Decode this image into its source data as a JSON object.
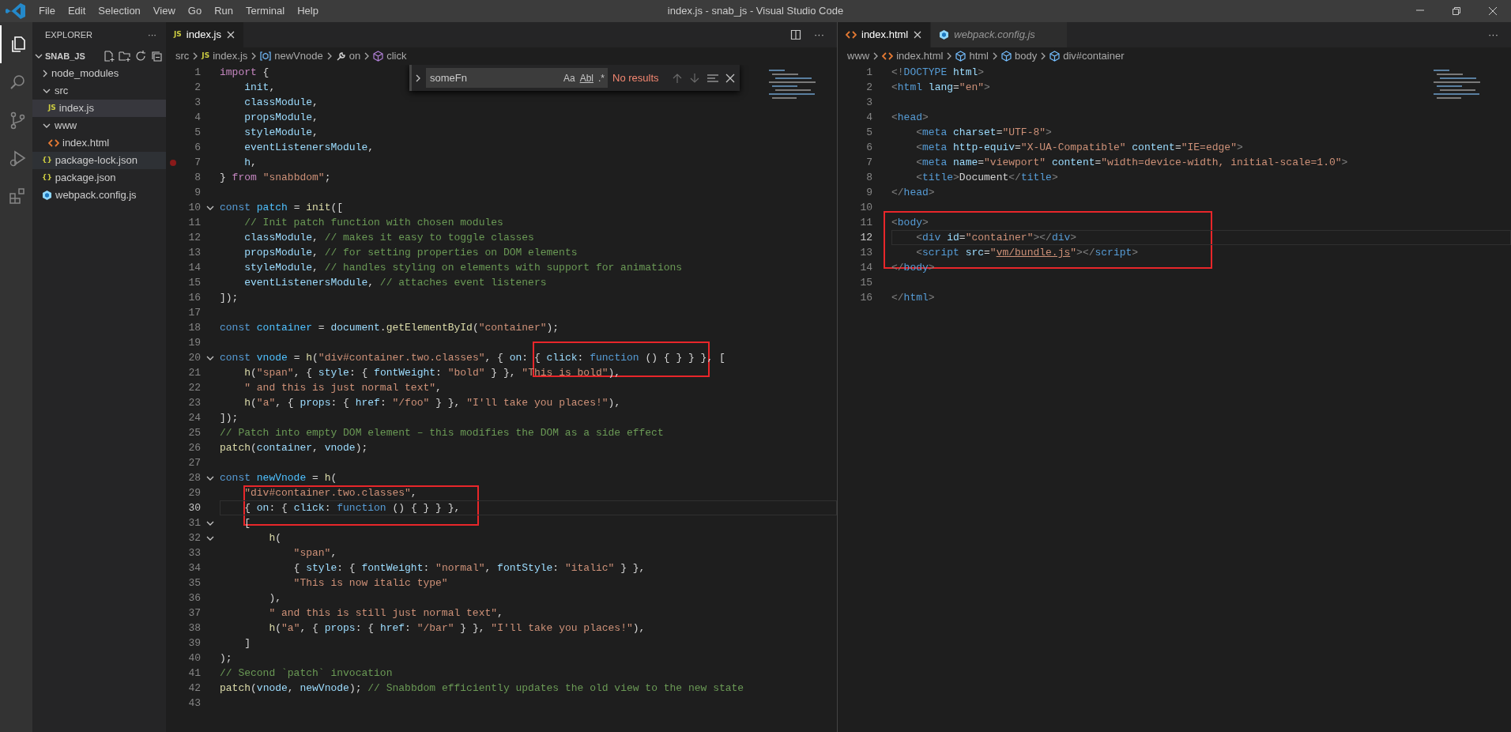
{
  "window": {
    "title": "index.js - snab_js - Visual Studio Code",
    "menu": [
      "File",
      "Edit",
      "Selection",
      "View",
      "Go",
      "Run",
      "Terminal",
      "Help"
    ]
  },
  "activity_bar": [
    {
      "kind": "files",
      "selected": true
    },
    {
      "kind": "search",
      "selected": false
    },
    {
      "kind": "source-control",
      "selected": false
    },
    {
      "kind": "debug",
      "selected": false
    },
    {
      "kind": "extensions",
      "selected": false
    }
  ],
  "sidebar": {
    "title": "EXPLORER",
    "more": "···",
    "section": {
      "label": "SNAB_JS",
      "expanded": true
    },
    "items": [
      {
        "label": "node_modules",
        "kind": "folder",
        "expanded": false,
        "selected": false,
        "hovered": false
      },
      {
        "label": "src",
        "kind": "folder",
        "expanded": true,
        "selected": false,
        "hovered": false,
        "children": [
          {
            "label": "index.js",
            "kind": "js",
            "badge": "JS",
            "selected": true,
            "hovered": false
          }
        ]
      },
      {
        "label": "www",
        "kind": "folder",
        "expanded": true,
        "selected": false,
        "hovered": false,
        "children": [
          {
            "label": "index.html",
            "kind": "html",
            "selected": false,
            "hovered": false
          }
        ]
      },
      {
        "label": "package-lock.json",
        "kind": "json",
        "badge": "{}",
        "selected": false,
        "hovered": true
      },
      {
        "label": "package.json",
        "kind": "json",
        "badge": "{}",
        "selected": false,
        "hovered": false
      },
      {
        "label": "webpack.config.js",
        "kind": "webpack",
        "selected": false,
        "hovered": false
      }
    ]
  },
  "editors": [
    {
      "tabs": [
        {
          "label": "index.js",
          "kind": "js",
          "badge": "JS",
          "selected": true,
          "preview": false
        }
      ],
      "actions": [
        {
          "kind": "split"
        },
        {
          "kind": "more",
          "label": "···"
        }
      ],
      "breadcrumbs": [
        {
          "label": "src",
          "kind": "folder"
        },
        {
          "label": "index.js",
          "kind": "js",
          "badge": "JS"
        },
        {
          "label": "newVnode",
          "kind": "variable"
        },
        {
          "label": "on",
          "kind": "property"
        },
        {
          "label": "click",
          "kind": "method"
        }
      ],
      "find": {
        "value": "someFn",
        "options": [
          "Aa",
          "Abl",
          ".*"
        ],
        "result": "No results"
      },
      "lines": [
        {
          "num": "1",
          "fold": false,
          "breakpoint": false,
          "current": false,
          "tokens": [
            {
              "kind": "ctl",
              "text": "import"
            },
            {
              "kind": "txt",
              "text": " {"
            }
          ]
        },
        {
          "num": "2",
          "fold": false,
          "breakpoint": false,
          "current": false,
          "tokens": [
            {
              "kind": "var",
              "text": "    init"
            },
            {
              "kind": "txt",
              "text": ","
            }
          ]
        },
        {
          "num": "3",
          "fold": false,
          "breakpoint": false,
          "current": false,
          "tokens": [
            {
              "kind": "var",
              "text": "    classModule"
            },
            {
              "kind": "txt",
              "text": ","
            }
          ]
        },
        {
          "num": "4",
          "fold": false,
          "breakpoint": false,
          "current": false,
          "tokens": [
            {
              "kind": "var",
              "text": "    propsModule"
            },
            {
              "kind": "txt",
              "text": ","
            }
          ]
        },
        {
          "num": "5",
          "fold": false,
          "breakpoint": false,
          "current": false,
          "tokens": [
            {
              "kind": "var",
              "text": "    styleModule"
            },
            {
              "kind": "txt",
              "text": ","
            }
          ]
        },
        {
          "num": "6",
          "fold": false,
          "breakpoint": false,
          "current": false,
          "tokens": [
            {
              "kind": "var",
              "text": "    eventListenersModule"
            },
            {
              "kind": "txt",
              "text": ","
            }
          ]
        },
        {
          "num": "7",
          "fold": false,
          "breakpoint": true,
          "current": false,
          "tokens": [
            {
              "kind": "var",
              "text": "    h"
            },
            {
              "kind": "txt",
              "text": ","
            }
          ]
        },
        {
          "num": "8",
          "fold": false,
          "breakpoint": false,
          "current": false,
          "tokens": [
            {
              "kind": "txt",
              "text": "} "
            },
            {
              "kind": "ctl",
              "text": "from "
            },
            {
              "kind": "str",
              "text": "\"snabbdom\""
            },
            {
              "kind": "txt",
              "text": ";"
            }
          ]
        },
        {
          "num": "9",
          "fold": false,
          "breakpoint": false,
          "current": false
        },
        {
          "num": "10",
          "fold": true,
          "breakpoint": false,
          "current": false,
          "tokens": [
            {
              "kind": "kw",
              "text": "const "
            },
            {
              "kind": "const",
              "text": "patch"
            },
            {
              "kind": "txt",
              "text": " = "
            },
            {
              "kind": "fn",
              "text": "init"
            },
            {
              "kind": "txt",
              "text": "(["
            }
          ]
        },
        {
          "num": "11",
          "fold": false,
          "breakpoint": false,
          "current": false,
          "tokens": [
            {
              "kind": "cmt",
              "text": "    // Init patch function with chosen modules"
            }
          ]
        },
        {
          "num": "12",
          "fold": false,
          "breakpoint": false,
          "current": false,
          "tokens": [
            {
              "kind": "var",
              "text": "    classModule"
            },
            {
              "kind": "txt",
              "text": ", "
            },
            {
              "kind": "cmt",
              "text": "// makes it easy to toggle classes"
            }
          ]
        },
        {
          "num": "13",
          "fold": false,
          "breakpoint": false,
          "current": false,
          "tokens": [
            {
              "kind": "var",
              "text": "    propsModule"
            },
            {
              "kind": "txt",
              "text": ", "
            },
            {
              "kind": "cmt",
              "text": "// for setting properties on DOM elements"
            }
          ]
        },
        {
          "num": "14",
          "fold": false,
          "breakpoint": false,
          "current": false,
          "tokens": [
            {
              "kind": "var",
              "text": "    styleModule"
            },
            {
              "kind": "txt",
              "text": ", "
            },
            {
              "kind": "cmt",
              "text": "// handles styling on elements with support for animations"
            }
          ]
        },
        {
          "num": "15",
          "fold": false,
          "breakpoint": false,
          "current": false,
          "tokens": [
            {
              "kind": "var",
              "text": "    eventListenersModule"
            },
            {
              "kind": "txt",
              "text": ", "
            },
            {
              "kind": "cmt",
              "text": "// attaches event listeners"
            }
          ]
        },
        {
          "num": "16",
          "fold": false,
          "breakpoint": false,
          "current": false,
          "tokens": [
            {
              "kind": "txt",
              "text": "]);"
            }
          ]
        },
        {
          "num": "17",
          "fold": false,
          "breakpoint": false,
          "current": false
        },
        {
          "num": "18",
          "fold": false,
          "breakpoint": false,
          "current": false,
          "tokens": [
            {
              "kind": "kw",
              "text": "const "
            },
            {
              "kind": "const",
              "text": "container"
            },
            {
              "kind": "txt",
              "text": " = "
            },
            {
              "kind": "var",
              "text": "document"
            },
            {
              "kind": "txt",
              "text": "."
            },
            {
              "kind": "fn",
              "text": "getElementById"
            },
            {
              "kind": "txt",
              "text": "("
            },
            {
              "kind": "str",
              "text": "\"container\""
            },
            {
              "kind": "txt",
              "text": ");"
            }
          ]
        },
        {
          "num": "19",
          "fold": false,
          "breakpoint": false,
          "current": false
        },
        {
          "num": "20",
          "fold": true,
          "breakpoint": false,
          "current": false,
          "tokens": [
            {
              "kind": "kw",
              "text": "const "
            },
            {
              "kind": "const",
              "text": "vnode"
            },
            {
              "kind": "txt",
              "text": " = "
            },
            {
              "kind": "fn",
              "text": "h"
            },
            {
              "kind": "txt",
              "text": "("
            },
            {
              "kind": "str",
              "text": "\"div#container.two.classes\""
            },
            {
              "kind": "txt",
              "text": ", { "
            },
            {
              "kind": "var",
              "text": "on"
            },
            {
              "kind": "txt",
              "text": ": { "
            },
            {
              "kind": "var",
              "text": "click"
            },
            {
              "kind": "txt",
              "text": ": "
            },
            {
              "kind": "kw",
              "text": "function"
            },
            {
              "kind": "txt",
              "text": " () { } } }, ["
            }
          ]
        },
        {
          "num": "21",
          "fold": false,
          "breakpoint": false,
          "current": false,
          "tokens": [
            {
              "kind": "fn",
              "text": "    h"
            },
            {
              "kind": "txt",
              "text": "("
            },
            {
              "kind": "str",
              "text": "\"span\""
            },
            {
              "kind": "txt",
              "text": ", { "
            },
            {
              "kind": "var",
              "text": "style"
            },
            {
              "kind": "txt",
              "text": ": { "
            },
            {
              "kind": "var",
              "text": "fontWeight"
            },
            {
              "kind": "txt",
              "text": ": "
            },
            {
              "kind": "str",
              "text": "\"bold\""
            },
            {
              "kind": "txt",
              "text": " } }, "
            },
            {
              "kind": "str",
              "text": "\"This is bold\""
            },
            {
              "kind": "txt",
              "text": "),"
            }
          ]
        },
        {
          "num": "22",
          "fold": false,
          "breakpoint": false,
          "current": false,
          "tokens": [
            {
              "kind": "str",
              "text": "    \" and this is just normal text\""
            },
            {
              "kind": "txt",
              "text": ","
            }
          ]
        },
        {
          "num": "23",
          "fold": false,
          "breakpoint": false,
          "current": false,
          "tokens": [
            {
              "kind": "fn",
              "text": "    h"
            },
            {
              "kind": "txt",
              "text": "("
            },
            {
              "kind": "str",
              "text": "\"a\""
            },
            {
              "kind": "txt",
              "text": ", { "
            },
            {
              "kind": "var",
              "text": "props"
            },
            {
              "kind": "txt",
              "text": ": { "
            },
            {
              "kind": "var",
              "text": "href"
            },
            {
              "kind": "txt",
              "text": ": "
            },
            {
              "kind": "str",
              "text": "\"/foo\""
            },
            {
              "kind": "txt",
              "text": " } }, "
            },
            {
              "kind": "str",
              "text": "\"I'll take you places!\""
            },
            {
              "kind": "txt",
              "text": "),"
            }
          ]
        },
        {
          "num": "24",
          "fold": false,
          "breakpoint": false,
          "current": false,
          "tokens": [
            {
              "kind": "txt",
              "text": "]);"
            }
          ]
        },
        {
          "num": "25",
          "fold": false,
          "breakpoint": false,
          "current": false,
          "tokens": [
            {
              "kind": "cmt",
              "text": "// Patch into empty DOM element – this modifies the DOM as a side effect"
            }
          ]
        },
        {
          "num": "26",
          "fold": false,
          "breakpoint": false,
          "current": false,
          "tokens": [
            {
              "kind": "fn",
              "text": "patch"
            },
            {
              "kind": "txt",
              "text": "("
            },
            {
              "kind": "var",
              "text": "container"
            },
            {
              "kind": "txt",
              "text": ", "
            },
            {
              "kind": "var",
              "text": "vnode"
            },
            {
              "kind": "txt",
              "text": ");"
            }
          ]
        },
        {
          "num": "27",
          "fold": false,
          "breakpoint": false,
          "current": false
        },
        {
          "num": "28",
          "fold": true,
          "breakpoint": false,
          "current": false,
          "tokens": [
            {
              "kind": "kw",
              "text": "const "
            },
            {
              "kind": "const",
              "text": "newVnode"
            },
            {
              "kind": "txt",
              "text": " = "
            },
            {
              "kind": "fn",
              "text": "h"
            },
            {
              "kind": "txt",
              "text": "("
            }
          ]
        },
        {
          "num": "29",
          "fold": false,
          "breakpoint": false,
          "current": false,
          "tokens": [
            {
              "kind": "str",
              "text": "    \"div#container.two.classes\""
            },
            {
              "kind": "txt",
              "text": ","
            }
          ]
        },
        {
          "num": "30",
          "fold": false,
          "breakpoint": false,
          "current": true,
          "tokens": [
            {
              "kind": "txt",
              "text": "    { "
            },
            {
              "kind": "var",
              "text": "on"
            },
            {
              "kind": "txt",
              "text": ": { "
            },
            {
              "kind": "var",
              "text": "click"
            },
            {
              "kind": "txt",
              "text": ": "
            },
            {
              "kind": "kw",
              "text": "function"
            },
            {
              "kind": "txt",
              "text": " () { } } },"
            }
          ]
        },
        {
          "num": "31",
          "fold": true,
          "breakpoint": false,
          "current": false,
          "tokens": [
            {
              "kind": "txt",
              "text": "    ["
            }
          ]
        },
        {
          "num": "32",
          "fold": true,
          "breakpoint": false,
          "current": false,
          "tokens": [
            {
              "kind": "fn",
              "text": "        h"
            },
            {
              "kind": "txt",
              "text": "("
            }
          ]
        },
        {
          "num": "33",
          "fold": false,
          "breakpoint": false,
          "current": false,
          "tokens": [
            {
              "kind": "str",
              "text": "            \"span\""
            },
            {
              "kind": "txt",
              "text": ","
            }
          ]
        },
        {
          "num": "34",
          "fold": false,
          "breakpoint": false,
          "current": false,
          "tokens": [
            {
              "kind": "txt",
              "text": "            { "
            },
            {
              "kind": "var",
              "text": "style"
            },
            {
              "kind": "txt",
              "text": ": { "
            },
            {
              "kind": "var",
              "text": "fontWeight"
            },
            {
              "kind": "txt",
              "text": ": "
            },
            {
              "kind": "str",
              "text": "\"normal\""
            },
            {
              "kind": "txt",
              "text": ", "
            },
            {
              "kind": "var",
              "text": "fontStyle"
            },
            {
              "kind": "txt",
              "text": ": "
            },
            {
              "kind": "str",
              "text": "\"italic\""
            },
            {
              "kind": "txt",
              "text": " } },"
            }
          ]
        },
        {
          "num": "35",
          "fold": false,
          "breakpoint": false,
          "current": false,
          "tokens": [
            {
              "kind": "str",
              "text": "            \"This is now italic type\""
            }
          ]
        },
        {
          "num": "36",
          "fold": false,
          "breakpoint": false,
          "current": false,
          "tokens": [
            {
              "kind": "txt",
              "text": "        ),"
            }
          ]
        },
        {
          "num": "37",
          "fold": false,
          "breakpoint": false,
          "current": false,
          "tokens": [
            {
              "kind": "str",
              "text": "        \" and this is still just normal text\""
            },
            {
              "kind": "txt",
              "text": ","
            }
          ]
        },
        {
          "num": "38",
          "fold": false,
          "breakpoint": false,
          "current": false,
          "tokens": [
            {
              "kind": "fn",
              "text": "        h"
            },
            {
              "kind": "txt",
              "text": "("
            },
            {
              "kind": "str",
              "text": "\"a\""
            },
            {
              "kind": "txt",
              "text": ", { "
            },
            {
              "kind": "var",
              "text": "props"
            },
            {
              "kind": "txt",
              "text": ": { "
            },
            {
              "kind": "var",
              "text": "href"
            },
            {
              "kind": "txt",
              "text": ": "
            },
            {
              "kind": "str",
              "text": "\"/bar\""
            },
            {
              "kind": "txt",
              "text": " } }, "
            },
            {
              "kind": "str",
              "text": "\"I'll take you places!\""
            },
            {
              "kind": "txt",
              "text": "),"
            }
          ]
        },
        {
          "num": "39",
          "fold": false,
          "breakpoint": false,
          "current": false,
          "tokens": [
            {
              "kind": "txt",
              "text": "    ]"
            }
          ]
        },
        {
          "num": "40",
          "fold": false,
          "breakpoint": false,
          "current": false,
          "tokens": [
            {
              "kind": "txt",
              "text": ");"
            }
          ]
        },
        {
          "num": "41",
          "fold": false,
          "breakpoint": false,
          "current": false,
          "tokens": [
            {
              "kind": "cmt",
              "text": "// Second `patch` invocation"
            }
          ]
        },
        {
          "num": "42",
          "fold": false,
          "breakpoint": false,
          "current": false,
          "tokens": [
            {
              "kind": "fn",
              "text": "patch"
            },
            {
              "kind": "txt",
              "text": "("
            },
            {
              "kind": "var",
              "text": "vnode"
            },
            {
              "kind": "txt",
              "text": ", "
            },
            {
              "kind": "var",
              "text": "newVnode"
            },
            {
              "kind": "txt",
              "text": "); "
            },
            {
              "kind": "cmt",
              "text": "// Snabbdom efficiently updates the old view to the new state"
            }
          ]
        },
        {
          "num": "43",
          "fold": false,
          "breakpoint": false,
          "current": false
        }
      ]
    },
    {
      "tabs": [
        {
          "label": "index.html",
          "kind": "html",
          "selected": true,
          "preview": false
        },
        {
          "label": "webpack.config.js",
          "kind": "webpack",
          "selected": false,
          "preview": true
        }
      ],
      "actions": [
        {
          "kind": "more",
          "label": "···"
        }
      ],
      "breadcrumbs": [
        {
          "label": "www",
          "kind": "folder"
        },
        {
          "label": "index.html",
          "kind": "html"
        },
        {
          "label": "html",
          "kind": "element"
        },
        {
          "label": "body",
          "kind": "element"
        },
        {
          "label": "div#container",
          "kind": "element"
        }
      ],
      "lines": [
        {
          "num": "1",
          "current": false,
          "tokens": [
            {
              "kind": "tag",
              "text": "<!"
            },
            {
              "kind": "kw",
              "text": "DOCTYPE "
            },
            {
              "kind": "var",
              "text": "html"
            },
            {
              "kind": "tag",
              "text": ">"
            }
          ]
        },
        {
          "num": "2",
          "current": false,
          "tokens": [
            {
              "kind": "tag",
              "text": "<"
            },
            {
              "kind": "kw",
              "text": "html "
            },
            {
              "kind": "var",
              "text": "lang"
            },
            {
              "kind": "txt",
              "text": "="
            },
            {
              "kind": "str",
              "text": "\"en\""
            },
            {
              "kind": "tag",
              "text": ">"
            }
          ]
        },
        {
          "num": "3",
          "current": false
        },
        {
          "num": "4",
          "current": false,
          "tokens": [
            {
              "kind": "tag",
              "text": "<"
            },
            {
              "kind": "kw",
              "text": "head"
            },
            {
              "kind": "tag",
              "text": ">"
            }
          ]
        },
        {
          "num": "5",
          "current": false,
          "tokens": [
            {
              "kind": "tag",
              "text": "    <"
            },
            {
              "kind": "kw",
              "text": "meta "
            },
            {
              "kind": "var",
              "text": "charset"
            },
            {
              "kind": "txt",
              "text": "="
            },
            {
              "kind": "str",
              "text": "\"UTF-8\""
            },
            {
              "kind": "tag",
              "text": ">"
            }
          ]
        },
        {
          "num": "6",
          "current": false,
          "tokens": [
            {
              "kind": "tag",
              "text": "    <"
            },
            {
              "kind": "kw",
              "text": "meta "
            },
            {
              "kind": "var",
              "text": "http-equiv"
            },
            {
              "kind": "txt",
              "text": "="
            },
            {
              "kind": "str",
              "text": "\"X-UA-Compatible\""
            },
            {
              "kind": "var",
              "text": " content"
            },
            {
              "kind": "txt",
              "text": "="
            },
            {
              "kind": "str",
              "text": "\"IE=edge\""
            },
            {
              "kind": "tag",
              "text": ">"
            }
          ]
        },
        {
          "num": "7",
          "current": false,
          "tokens": [
            {
              "kind": "tag",
              "text": "    <"
            },
            {
              "kind": "kw",
              "text": "meta "
            },
            {
              "kind": "var",
              "text": "name"
            },
            {
              "kind": "txt",
              "text": "="
            },
            {
              "kind": "str",
              "text": "\"viewport\""
            },
            {
              "kind": "var",
              "text": " content"
            },
            {
              "kind": "txt",
              "text": "="
            },
            {
              "kind": "str",
              "text": "\"width=device-width, initial-scale=1.0\""
            },
            {
              "kind": "tag",
              "text": ">"
            }
          ]
        },
        {
          "num": "8",
          "current": false,
          "tokens": [
            {
              "kind": "tag",
              "text": "    <"
            },
            {
              "kind": "kw",
              "text": "title"
            },
            {
              "kind": "tag",
              "text": ">"
            },
            {
              "kind": "txt",
              "text": "Document"
            },
            {
              "kind": "tag",
              "text": "</"
            },
            {
              "kind": "kw",
              "text": "title"
            },
            {
              "kind": "tag",
              "text": ">"
            }
          ]
        },
        {
          "num": "9",
          "current": false,
          "tokens": [
            {
              "kind": "tag",
              "text": "</"
            },
            {
              "kind": "kw",
              "text": "head"
            },
            {
              "kind": "tag",
              "text": ">"
            }
          ]
        },
        {
          "num": "10",
          "current": false
        },
        {
          "num": "11",
          "current": false,
          "tokens": [
            {
              "kind": "tag",
              "text": "<"
            },
            {
              "kind": "kw",
              "text": "body"
            },
            {
              "kind": "tag",
              "text": ">"
            }
          ]
        },
        {
          "num": "12",
          "current": true,
          "tokens": [
            {
              "kind": "tag",
              "text": "    <"
            },
            {
              "kind": "kw",
              "text": "div "
            },
            {
              "kind": "var",
              "text": "id"
            },
            {
              "kind": "txt",
              "text": "="
            },
            {
              "kind": "str",
              "text": "\"container\""
            },
            {
              "kind": "tag",
              "text": "></"
            },
            {
              "kind": "kw",
              "text": "div"
            },
            {
              "kind": "tag",
              "text": ">"
            }
          ]
        },
        {
          "num": "13",
          "current": false,
          "tokens": [
            {
              "kind": "tag",
              "text": "    <"
            },
            {
              "kind": "kw",
              "text": "script "
            },
            {
              "kind": "var",
              "text": "src"
            },
            {
              "kind": "txt",
              "text": "="
            },
            {
              "kind": "str",
              "text": "\""
            },
            {
              "kind": "link",
              "text": "vm/bundle.js"
            },
            {
              "kind": "str",
              "text": "\""
            },
            {
              "kind": "tag",
              "text": "></"
            },
            {
              "kind": "kw",
              "text": "script"
            },
            {
              "kind": "tag",
              "text": ">"
            }
          ]
        },
        {
          "num": "14",
          "current": false,
          "tokens": [
            {
              "kind": "tag",
              "text": "</"
            },
            {
              "kind": "kw",
              "text": "body"
            },
            {
              "kind": "tag",
              "text": ">"
            }
          ]
        },
        {
          "num": "15",
          "current": false
        },
        {
          "num": "16",
          "current": false,
          "tokens": [
            {
              "kind": "tag",
              "text": "</"
            },
            {
              "kind": "kw",
              "text": "html"
            },
            {
              "kind": "tag",
              "text": ">"
            }
          ]
        }
      ]
    }
  ]
}
